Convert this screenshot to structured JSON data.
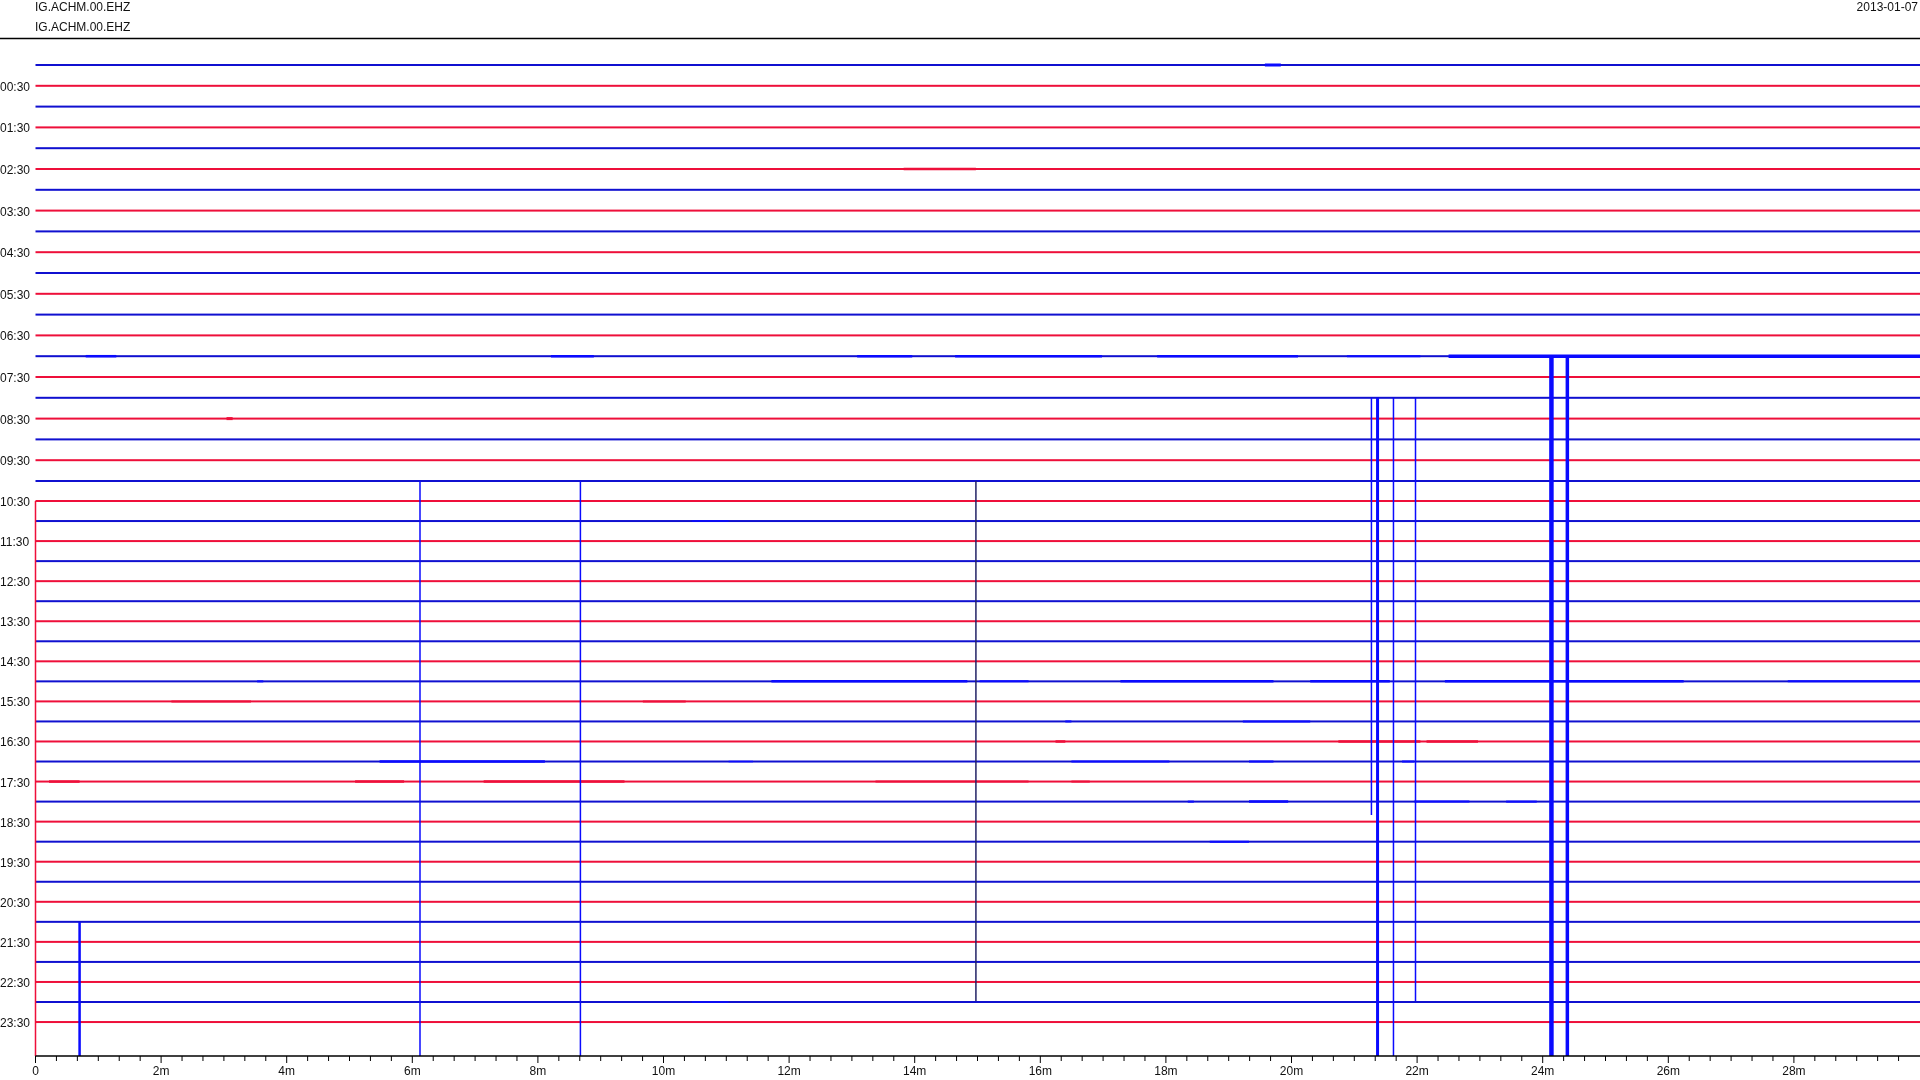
{
  "header": {
    "station_labels": [
      "IG.ACHM.00.EHZ",
      "IG.ACHM.00.EHZ"
    ],
    "date": "2013-01-07"
  },
  "plot": {
    "traces": [
      {
        "color": "#1010d0"
      },
      {
        "color": "#ee0f3a",
        "label": "00:30"
      },
      {
        "color": "#1010d0"
      },
      {
        "color": "#ee0f3a",
        "label": "01:30"
      },
      {
        "color": "#1010d0"
      },
      {
        "color": "#ee0f3a",
        "label": "02:30"
      },
      {
        "color": "#1010d0"
      },
      {
        "color": "#ee0f3a",
        "label": "03:30"
      },
      {
        "color": "#1010d0"
      },
      {
        "color": "#ee0f3a",
        "label": "04:30"
      },
      {
        "color": "#1010d0"
      },
      {
        "color": "#ee0f3a",
        "label": "05:30"
      },
      {
        "color": "#1010d0"
      },
      {
        "color": "#ee0f3a",
        "label": "06:30"
      },
      {
        "color": "#1010d0"
      },
      {
        "color": "#ee0f3a",
        "label": "07:30"
      },
      {
        "color": "#1010d0"
      },
      {
        "color": "#ee0f3a",
        "label": "08:30"
      },
      {
        "color": "#1010d0"
      },
      {
        "color": "#ee0f3a",
        "label": "09:30"
      },
      {
        "color": "#1010d0"
      },
      {
        "color": "#ee0f3a",
        "label": "10:30"
      },
      {
        "color": "#1010d0"
      },
      {
        "color": "#ee0f3a",
        "label": "11:30"
      },
      {
        "color": "#1010d0"
      },
      {
        "color": "#ee0f3a",
        "label": "12:30"
      },
      {
        "color": "#1010d0"
      },
      {
        "color": "#ee0f3a",
        "label": "13:30"
      },
      {
        "color": "#1010d0"
      },
      {
        "color": "#ee0f3a",
        "label": "14:30"
      },
      {
        "color": "#1010d0"
      },
      {
        "color": "#ee0f3a",
        "label": "15:30"
      },
      {
        "color": "#1010d0"
      },
      {
        "color": "#ee0f3a",
        "label": "16:30"
      },
      {
        "color": "#1010d0"
      },
      {
        "color": "#ee0f3a",
        "label": "17:30"
      },
      {
        "color": "#1010d0"
      },
      {
        "color": "#ee0f3a",
        "label": "18:30"
      },
      {
        "color": "#1010d0"
      },
      {
        "color": "#ee0f3a",
        "label": "19:30"
      },
      {
        "color": "#1010d0"
      },
      {
        "color": "#ee0f3a",
        "label": "20:30"
      },
      {
        "color": "#1010d0"
      },
      {
        "color": "#ee0f3a",
        "label": "21:30"
      },
      {
        "color": "#1010d0"
      },
      {
        "color": "#ee0f3a",
        "label": "22:30"
      },
      {
        "color": "#1010d0"
      },
      {
        "color": "#ee0f3a",
        "label": "23:30"
      }
    ],
    "x_tick_labels": [
      "0",
      "2m",
      "4m",
      "6m",
      "8m",
      "10m",
      "12m",
      "14m",
      "16m",
      "18m",
      "20m",
      "22m",
      "24m",
      "26m",
      "28m"
    ]
  }
}
